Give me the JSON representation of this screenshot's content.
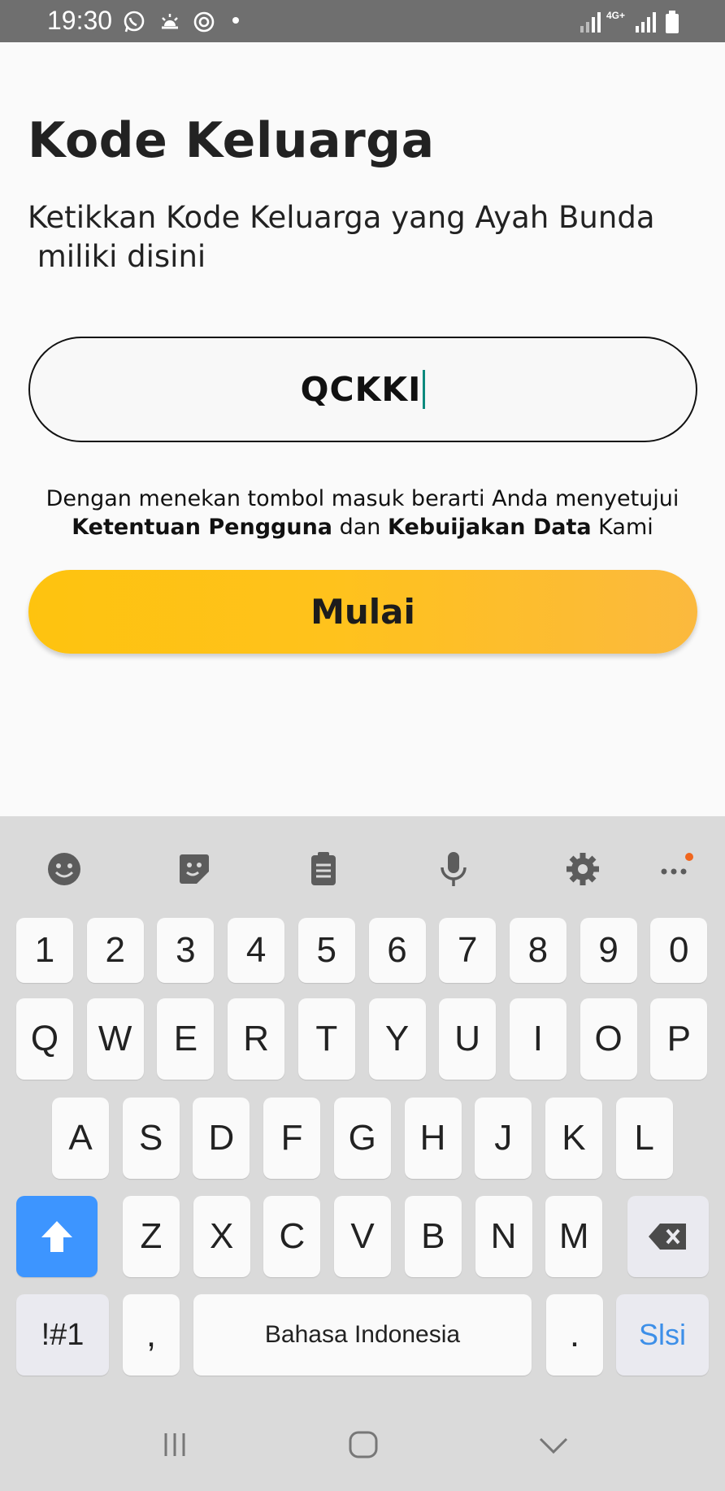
{
  "status_bar": {
    "time": "19:30",
    "icons": [
      "whatsapp-icon",
      "weather-icon",
      "sync-icon",
      "dot-icon",
      "signal-icon",
      "4g-icon",
      "signal-icon",
      "battery-icon"
    ],
    "network": "4G+"
  },
  "page": {
    "title": "Kode Keluarga",
    "subtitle": "Ketikkan Kode Keluarga yang Ayah Bunda\n miliki disini"
  },
  "code_input": {
    "value": "QCKKI"
  },
  "terms": {
    "prefix": "Dengan menekan tombol masuk berarti Anda menyetujui",
    "link1": "Ketentuan Pengguna",
    "middle": " dan ",
    "link2": "Kebuijakan Data",
    "suffix": " Kami"
  },
  "start_button": {
    "label": "Mulai"
  },
  "keyboard": {
    "toolbar": [
      "emoji-icon",
      "sticker-icon",
      "clipboard-icon",
      "microphone-icon",
      "settings-icon",
      "more-icon"
    ],
    "row_numbers": [
      "1",
      "2",
      "3",
      "4",
      "5",
      "6",
      "7",
      "8",
      "9",
      "0"
    ],
    "row1": [
      "Q",
      "W",
      "E",
      "R",
      "T",
      "Y",
      "U",
      "I",
      "O",
      "P"
    ],
    "row2": [
      "A",
      "S",
      "D",
      "F",
      "G",
      "H",
      "J",
      "K",
      "L"
    ],
    "row3": [
      "Z",
      "X",
      "C",
      "V",
      "B",
      "N",
      "M"
    ],
    "symbols_label": "!#1",
    "comma_label": ",",
    "space_label": "Bahasa Indonesia",
    "period_label": ".",
    "done_label": "Slsi",
    "accent_color": "#3d95ff",
    "notification_dot_color": "#f0661e"
  },
  "nav_bar": {
    "icons": [
      "recent-apps-icon",
      "home-icon",
      "back-icon"
    ]
  }
}
